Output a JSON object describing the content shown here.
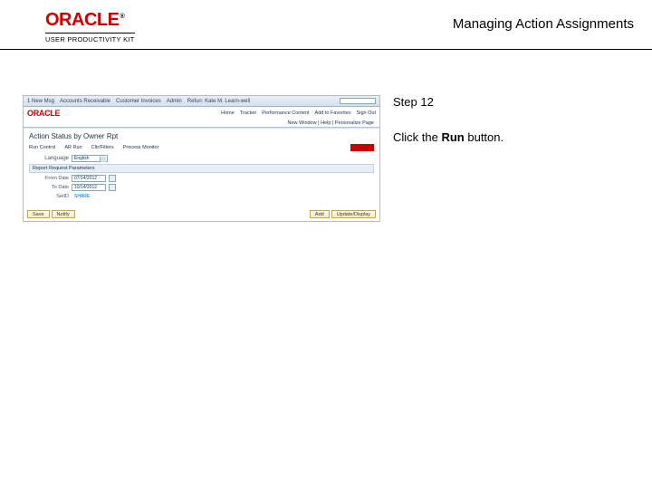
{
  "header": {
    "logo_text": "ORACLE",
    "upk_label": "USER PRODUCTIVITY KIT",
    "title": "Managing Action Assignments"
  },
  "instructions": {
    "step_label": "Step 12",
    "line_a": "Click the ",
    "bold": "Run",
    "line_b": " button."
  },
  "shot": {
    "top": {
      "a": "1 New Msg",
      "b": "Accounts Receivable",
      "c": "Customer Invoices",
      "d": "Admin",
      "e": "Refun:  Kate M. Learn-well"
    },
    "nav": {
      "a": "Home",
      "b": "Tracker",
      "c": "Performance Content",
      "d": "Add to Favorites",
      "e": "Sign Out"
    },
    "breadcrumb": "New Window | Help | Personalize Page",
    "page_title": "Action Status by Owner Rpt",
    "tabs": {
      "a": "Run Control",
      "b": "AR Run",
      "c": "Cltr/Filters",
      "d": "Process Monitor"
    },
    "section_hd": "Report Request Parameters",
    "fields": {
      "from_lbl": "From Date",
      "from_val": "07/14/2012",
      "to_lbl": "To Date",
      "to_val": "10/14/2012",
      "setid_lbl": "SetID",
      "setid_val": "SHARE",
      "lang_lbl": "Language",
      "lang_val": "English"
    },
    "footer": {
      "save": "Save",
      "notify": "Notify",
      "add": "Add",
      "updisp": "Update/Display"
    }
  }
}
